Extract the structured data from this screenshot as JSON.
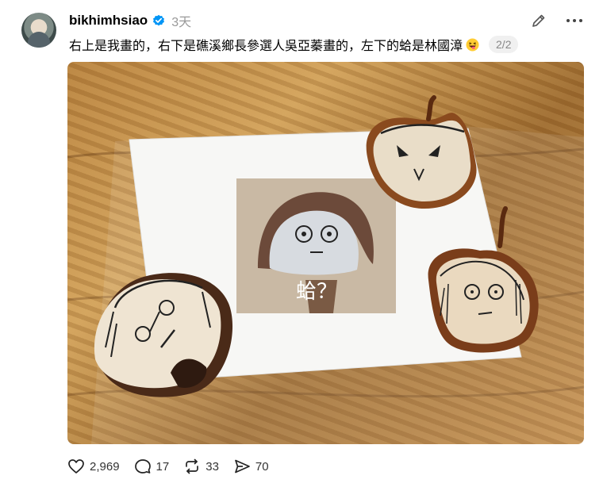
{
  "post": {
    "username": "bikhimhsiao",
    "time": "3天",
    "text": "右上是我畫的，右下是礁溪鄉長參選人吳亞蓁畫的，左下的蛤是林國漳",
    "page_indicator": "2/2",
    "photo_caption": "蛤？"
  },
  "actions": {
    "likes": "2,969",
    "comments": "17",
    "reposts": "33",
    "shares": "70"
  },
  "icons": {
    "verified": "verified-badge-icon",
    "edit": "pencil-icon",
    "more": "more-dots-icon",
    "emoji": "grinning-tongue-emoji",
    "like": "heart-icon",
    "comment": "comment-bubble-icon",
    "repost": "repost-arrows-icon",
    "share": "send-arrow-icon"
  },
  "colors": {
    "verified": "#0095f6",
    "muted_text": "#999999"
  }
}
